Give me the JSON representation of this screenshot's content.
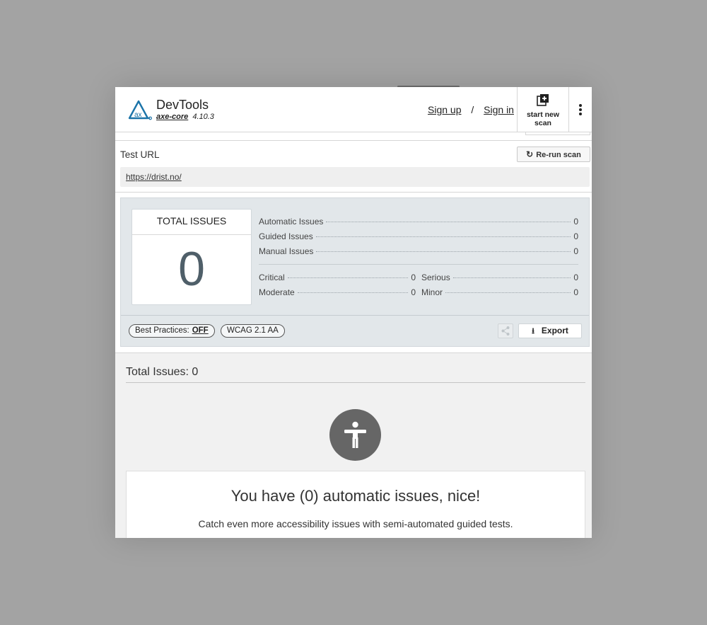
{
  "brand": {
    "title": "DevTools",
    "core_name": "axe-core",
    "version": "4.10.3",
    "logo_text": "ax"
  },
  "auth": {
    "sign_up": "Sign up",
    "separator": "/",
    "sign_in": "Sign in"
  },
  "new_scan": {
    "line1": "start new",
    "line2": "scan"
  },
  "test_url": {
    "label": "Test URL",
    "rerun_label": "Re-run scan",
    "url": "https://drist.no/"
  },
  "summary": {
    "total_label": "TOTAL ISSUES",
    "total_value": "0",
    "automatic": {
      "label": "Automatic Issues",
      "value": "0"
    },
    "guided": {
      "label": "Guided Issues",
      "value": "0"
    },
    "manual": {
      "label": "Manual Issues",
      "value": "0"
    },
    "critical": {
      "label": "Critical",
      "value": "0"
    },
    "serious": {
      "label": "Serious",
      "value": "0"
    },
    "moderate": {
      "label": "Moderate",
      "value": "0"
    },
    "minor": {
      "label": "Minor",
      "value": "0"
    },
    "best_practices_label": "Best Practices:",
    "best_practices_value": "OFF",
    "wcag_label": "WCAG 2.1 AA",
    "export_label": "Export"
  },
  "results": {
    "title": "Total Issues: 0",
    "empty_title": "You have (0) automatic issues, nice!",
    "empty_sub": "Catch even more accessibility issues with semi-automated guided tests."
  },
  "colors": {
    "accent": "#1a73a8",
    "summary_bg": "#e2e7ea",
    "total_number": "#4f5f69",
    "icon_circle": "#666666"
  }
}
